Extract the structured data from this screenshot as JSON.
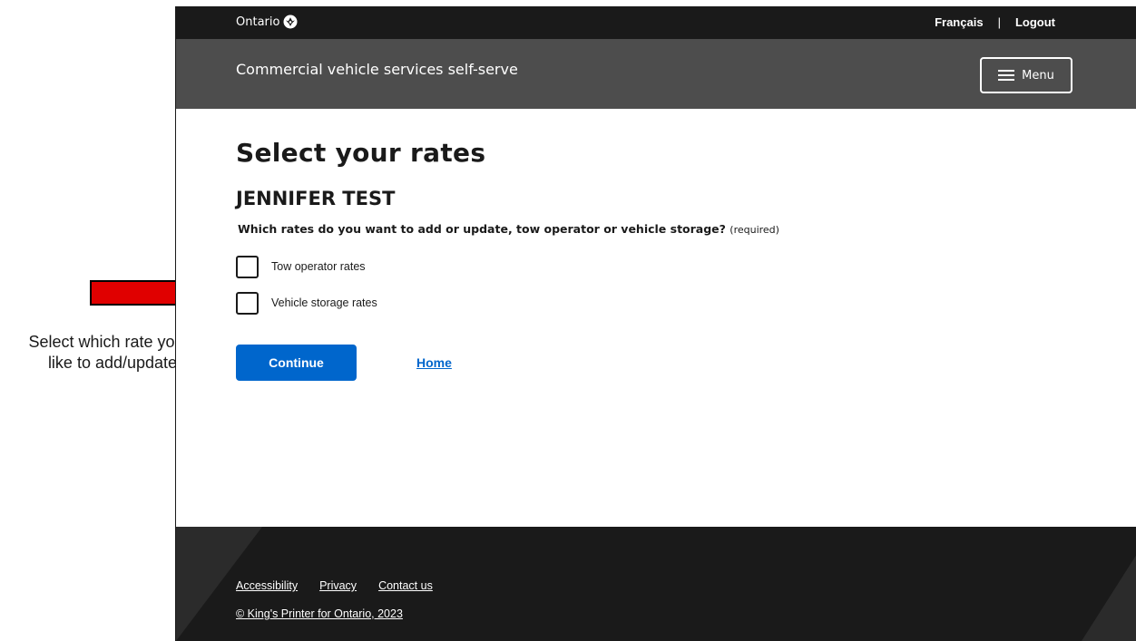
{
  "annotation": {
    "caption_line1": "Select which rate you’d",
    "caption_line2": "like to add/update",
    "arrow_color": "#e00000"
  },
  "header": {
    "logo_text": "Ontario",
    "lang_link": "Français",
    "separator": "|",
    "logout_link": "Logout",
    "service_title": "Commercial vehicle services self-serve",
    "menu_label": "Menu"
  },
  "main": {
    "title": "Select your rates",
    "person_name": "JENNIFER TEST",
    "question": "Which rates do you want to add or update, tow operator or vehicle storage?",
    "required_note": "(required)",
    "options": [
      {
        "label": "Tow operator rates",
        "checked": false
      },
      {
        "label": "Vehicle storage rates",
        "checked": false
      }
    ],
    "continue_label": "Continue",
    "home_link": "Home"
  },
  "footer": {
    "links": [
      "Accessibility",
      "Privacy",
      "Contact us"
    ],
    "copyright": "© King's Printer for Ontario, 2023"
  },
  "colors": {
    "top_bar": "#1a1a1a",
    "service_bar": "#4d4d4d",
    "primary_button": "#0066cc",
    "link": "#0066cc",
    "footer": "#1a1a1a"
  },
  "icons": {
    "logo": "ontario-trillium-icon",
    "menu": "hamburger-icon",
    "annotation": "arrow-right-icon"
  }
}
